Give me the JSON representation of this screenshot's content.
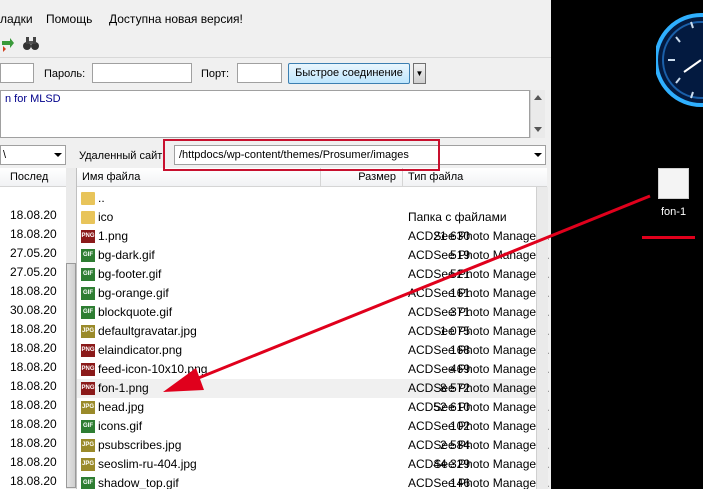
{
  "menu": {
    "item_bookmarks_partial": "ладки",
    "item_help": "Помощь",
    "item_update": "Доступна новая версия!"
  },
  "quickconnect": {
    "password_label": "Пароль:",
    "port_label": "Порт:",
    "connect_button": "Быстрое соединение",
    "dropdown_icon": "chevron-down-icon"
  },
  "log": {
    "line": "n for MLSD"
  },
  "left": {
    "path_value": "\\",
    "col_modified_partial": "Послед",
    "dates": [
      "18.08.20",
      "18.08.20",
      "27.05.20",
      "27.05.20",
      "18.08.20",
      "30.08.20",
      "18.08.20",
      "18.08.20",
      "18.08.20",
      "18.08.20",
      "18.08.20",
      "18.08.20",
      "18.08.20",
      "18.08.20",
      "18.08.20"
    ]
  },
  "remote": {
    "label": "Удаленный сайт:",
    "path": "/httpdocs/wp-content/themes/Prosumer/images",
    "columns": {
      "name": "Имя файла",
      "size": "Размер",
      "type": "Тип файла"
    },
    "files": [
      {
        "name": "..",
        "size": "",
        "type": "",
        "icon": "folder"
      },
      {
        "name": "ico",
        "size": "",
        "type": "Папка с файлами",
        "icon": "folder"
      },
      {
        "name": "1.png",
        "size": "21 630",
        "type": "ACDSee Photo Manager...",
        "icon": "png"
      },
      {
        "name": "bg-dark.gif",
        "size": "519",
        "type": "ACDSee Photo Manager...",
        "icon": "gif"
      },
      {
        "name": "bg-footer.gif",
        "size": "521",
        "type": "ACDSee Photo Manager...",
        "icon": "gif"
      },
      {
        "name": "bg-orange.gif",
        "size": "161",
        "type": "ACDSee Photo Manager...",
        "icon": "gif"
      },
      {
        "name": "blockquote.gif",
        "size": "371",
        "type": "ACDSee Photo Manager...",
        "icon": "gif"
      },
      {
        "name": "defaultgravatar.jpg",
        "size": "1 075",
        "type": "ACDSee Photo Manager...",
        "icon": "jpg"
      },
      {
        "name": "elaindicator.png",
        "size": "168",
        "type": "ACDSee Photo Manager...",
        "icon": "png"
      },
      {
        "name": "feed-icon-10x10.png",
        "size": "469",
        "type": "ACDSee Photo Manager...",
        "icon": "png"
      },
      {
        "name": "fon-1.png",
        "size": "8 572",
        "type": "ACDSee Photo Manager...",
        "icon": "png"
      },
      {
        "name": "head.jpg",
        "size": "52 610",
        "type": "ACDSee Photo Manager...",
        "icon": "jpg"
      },
      {
        "name": "icons.gif",
        "size": "102",
        "type": "ACDSee Photo Manager...",
        "icon": "gif"
      },
      {
        "name": "psubscribes.jpg",
        "size": "2 584",
        "type": "ACDSee Photo Manager...",
        "icon": "jpg"
      },
      {
        "name": "seoslim-ru-404.jpg",
        "size": "44 329",
        "type": "ACDSee Photo Manager...",
        "icon": "jpg"
      },
      {
        "name": "shadow_top.gif",
        "size": "146",
        "type": "ACDSee Photo Manager...",
        "icon": "gif"
      }
    ]
  },
  "desktop": {
    "icon_label": "fon-1"
  },
  "colors": {
    "annotation_red": "#e0001c",
    "folder": "#e8c45a",
    "png_icon": "#8b1a1a",
    "gif_icon": "#2e7d32",
    "jpg_icon": "#9a8a2a"
  }
}
